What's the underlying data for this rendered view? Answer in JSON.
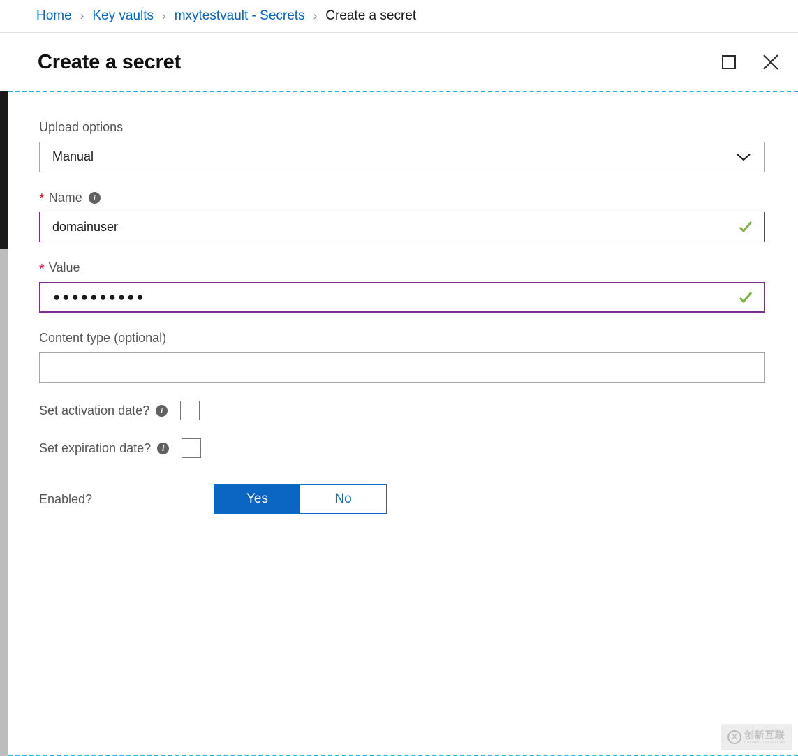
{
  "breadcrumb": {
    "items": [
      {
        "label": "Home",
        "type": "link"
      },
      {
        "label": "Key vaults",
        "type": "link"
      },
      {
        "label": "mxytestvault - Secrets",
        "type": "link"
      },
      {
        "label": "Create a secret",
        "type": "current"
      }
    ],
    "separator": "›"
  },
  "blade": {
    "title": "Create a secret",
    "maximize_icon": "maximize-icon",
    "close_icon": "close-icon"
  },
  "form": {
    "upload_options": {
      "label": "Upload options",
      "value": "Manual",
      "chevron_icon": "chevron-down-icon"
    },
    "name": {
      "label": "Name",
      "required_marker": "*",
      "info_icon": "info-icon",
      "info_glyph": "i",
      "value": "domainuser",
      "placeholder": "",
      "validation_icon": "checkmark-icon",
      "valid": true
    },
    "value": {
      "label": "Value",
      "required_marker": "*",
      "value": "●●●●●●●●●●",
      "masked_character_count": 10,
      "placeholder": "",
      "validation_icon": "checkmark-icon",
      "valid": true
    },
    "content_type": {
      "label": "Content type (optional)",
      "value": "",
      "placeholder": ""
    },
    "set_activation_date": {
      "label": "Set activation date?",
      "info_icon": "info-icon",
      "info_glyph": "i",
      "checked": false
    },
    "set_expiration_date": {
      "label": "Set expiration date?",
      "info_icon": "info-icon",
      "info_glyph": "i",
      "checked": false
    },
    "enabled": {
      "label": "Enabled?",
      "yes_label": "Yes",
      "no_label": "No",
      "selected": "Yes"
    }
  },
  "watermark": {
    "logo_glyph": "X",
    "text_cn": "创新互联",
    "text_en": "CHUANG XIN HU LIAN"
  },
  "colors": {
    "link": "#0066cc",
    "required": "#d6183b",
    "valid_border": "#7b2d8e",
    "valid_check": "#7cb342",
    "toggle_selected": "#0b66c3",
    "focus_outline": "#19b5e8",
    "rail_dark": "#1b1a19"
  }
}
